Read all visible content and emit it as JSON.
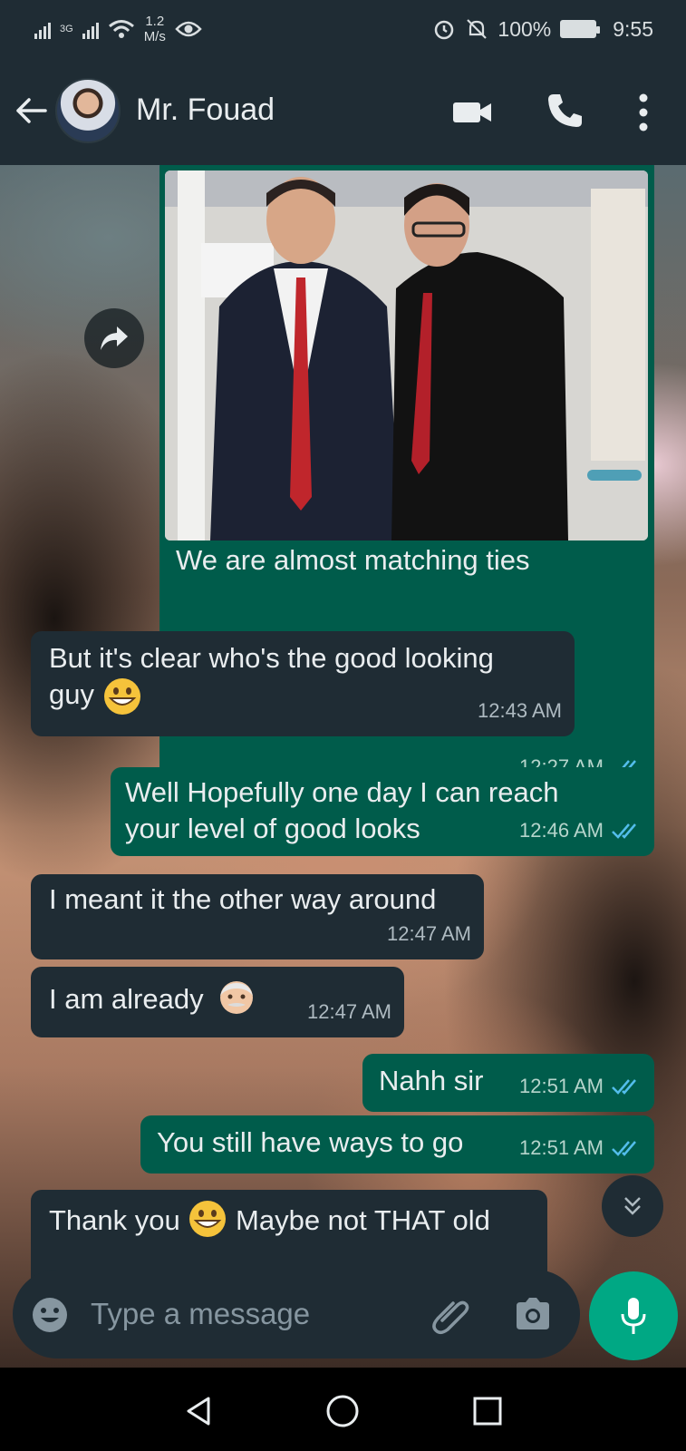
{
  "status_bar": {
    "network": "3G",
    "speed_value": "1.2",
    "speed_unit": "M/s",
    "battery": "100%",
    "time": "9:55"
  },
  "header": {
    "contact_name": "Mr. Fouad"
  },
  "messages": [
    {
      "direction": "out",
      "type": "image",
      "caption": "We are almost matching ties",
      "time": "12:27 AM",
      "status": "read"
    },
    {
      "direction": "in",
      "text_line1": "But it's clear who's the good looking",
      "text_line2": "guy",
      "emoji": "grinning-face-emoji",
      "time": "12:43 AM"
    },
    {
      "direction": "out",
      "text_line1": "Well Hopefully one day I can reach",
      "text_line2": "your level of good looks",
      "time": "12:46 AM",
      "status": "read"
    },
    {
      "direction": "in",
      "text": "I meant it the other way around",
      "time": "12:47 AM"
    },
    {
      "direction": "in",
      "text": "I am already",
      "emoji": "old-man-emoji",
      "time": "12:47 AM"
    },
    {
      "direction": "out",
      "text": "Nahh sir",
      "time": "12:51 AM",
      "status": "read"
    },
    {
      "direction": "out",
      "text": "You still have ways to go",
      "time": "12:51 AM",
      "status": "read"
    },
    {
      "direction": "in",
      "text_part1": "Thank you",
      "emoji": "grinning-face-emoji",
      "text_part2": "Maybe not THAT old"
    }
  ],
  "composer": {
    "placeholder": "Type a message"
  },
  "colors": {
    "header_bg": "#1f2c34",
    "incoming_bubble": "#1f2c34",
    "outgoing_bubble": "#005c4b",
    "read_ticks": "#53bdeb",
    "accent": "#00a884"
  },
  "icons": [
    "back-arrow-icon",
    "video-call-icon",
    "phone-icon",
    "more-options-icon",
    "forward-icon",
    "double-chevron-down-icon",
    "emoji-icon",
    "paperclip-icon",
    "camera-icon",
    "microphone-icon",
    "nav-back-icon",
    "nav-home-icon",
    "nav-recents-icon"
  ]
}
